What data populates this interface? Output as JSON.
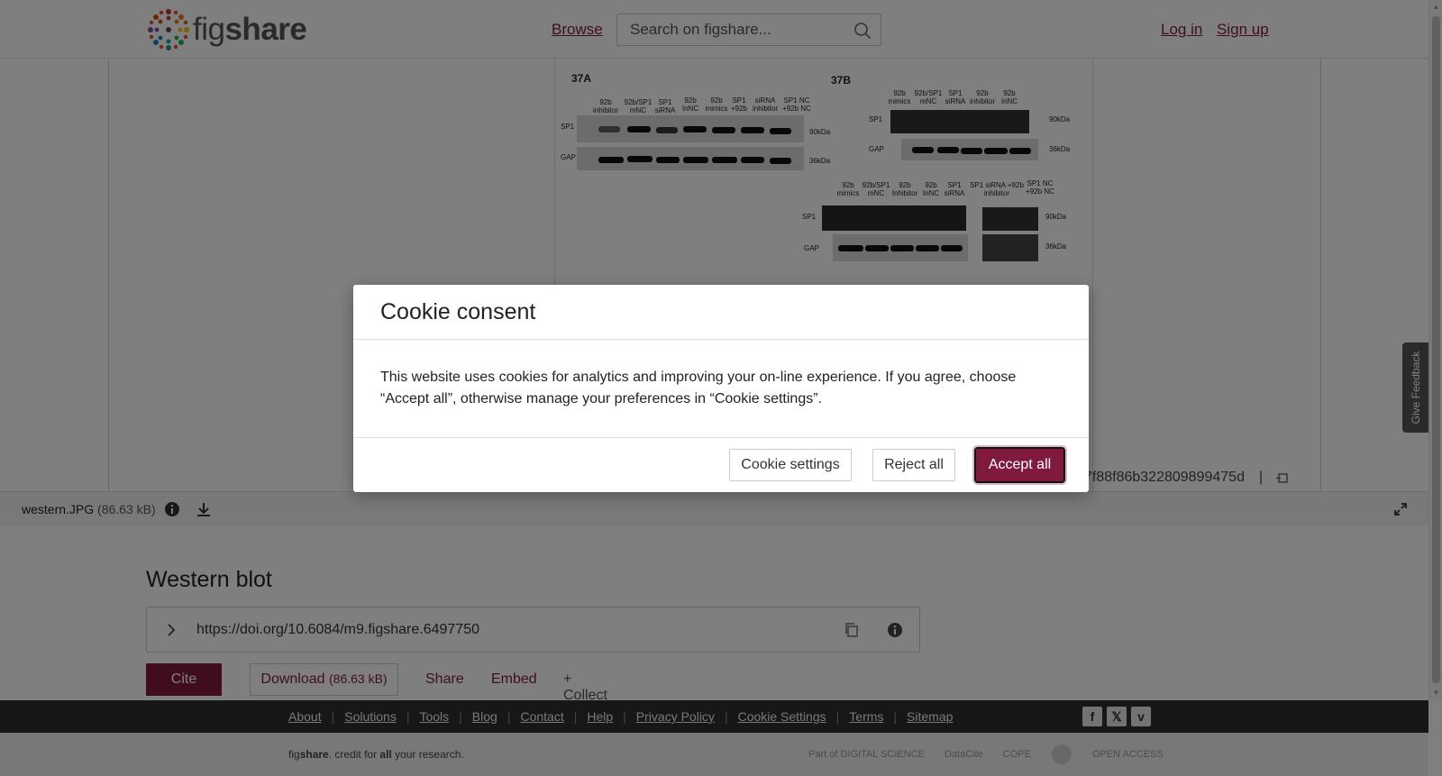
{
  "header": {
    "logo_text_light": "fig",
    "logo_text_bold": "share",
    "browse": "Browse",
    "search_placeholder": "Search on figshare...",
    "login": "Log in",
    "signup": "Sign up"
  },
  "preview": {
    "figure_labels": [
      "37A",
      "37B"
    ],
    "fig_a": {
      "columns": [
        "92b inhibitor",
        "92b/SP1 mNC",
        "SP1 siRNA",
        "92b InNC",
        "92b mimics",
        "SP1 +92b",
        "siRNA inhibitor",
        "SP1 NC +92b NC"
      ],
      "rows": [
        "SP1",
        "GAP"
      ],
      "markers": [
        "90kDa",
        "36kDa"
      ]
    },
    "fig_b_top": {
      "columns": [
        "92b mimics",
        "92b/SP1 mNC",
        "SP1 siRNA",
        "92b inhibitor",
        "92b InNC"
      ],
      "rows": [
        "SP1",
        "GAP"
      ],
      "markers": [
        "90kDa",
        "36kDa"
      ]
    },
    "fig_b_bottom": {
      "columns": [
        "92b mimics",
        "92b/SP1 mNC",
        "92b Inhibitor",
        "92b InNC",
        "SP1 siRNA",
        "SP1 siRNA +92b inhibitor",
        "SP1 NC +92b NC"
      ],
      "rows": [
        "SP1",
        "GAP"
      ],
      "markers": [
        "90kDa",
        "36kDa"
      ]
    },
    "hash_text": "7f88f86b322809899475d",
    "hash_sep": "|"
  },
  "filebar": {
    "filename": "western.JPG",
    "size": "(86.63 kB)"
  },
  "item": {
    "title": "Western blot",
    "doi": "https://doi.org/10.6084/m9.figshare.6497750",
    "cite": "Cite",
    "download": "Download",
    "download_size": "(86.63 kB)",
    "share": "Share",
    "embed": "Embed",
    "collect": "+ Collect"
  },
  "footer": {
    "links": [
      "About",
      "Solutions",
      "Tools",
      "Blog",
      "Contact",
      "Help",
      "Privacy Policy",
      "Cookie Settings",
      "Terms",
      "Sitemap"
    ],
    "tagline_pre": "fig",
    "tagline_bold": "share",
    "tagline_mid": ". credit for ",
    "tagline_all": "all",
    "tagline_end": " your research.",
    "partners": [
      "Part of DIGITAL SCIENCE",
      "DataCite",
      "COPE",
      "",
      "OPEN ACCESS"
    ],
    "social_icons": [
      "facebook-icon",
      "x-icon",
      "vimeo-icon"
    ]
  },
  "feedback": "Give Feedback",
  "modal": {
    "title": "Cookie consent",
    "body": "This website uses cookies for analytics and improving your on-line experience. If you agree, choose “Accept all”, otherwise manage your preferences in “Cookie settings”.",
    "settings": "Cookie settings",
    "reject": "Reject all",
    "accept": "Accept all"
  },
  "colors": {
    "brand": "#7f1a3e",
    "footer_dark": "#2e2e2e"
  }
}
